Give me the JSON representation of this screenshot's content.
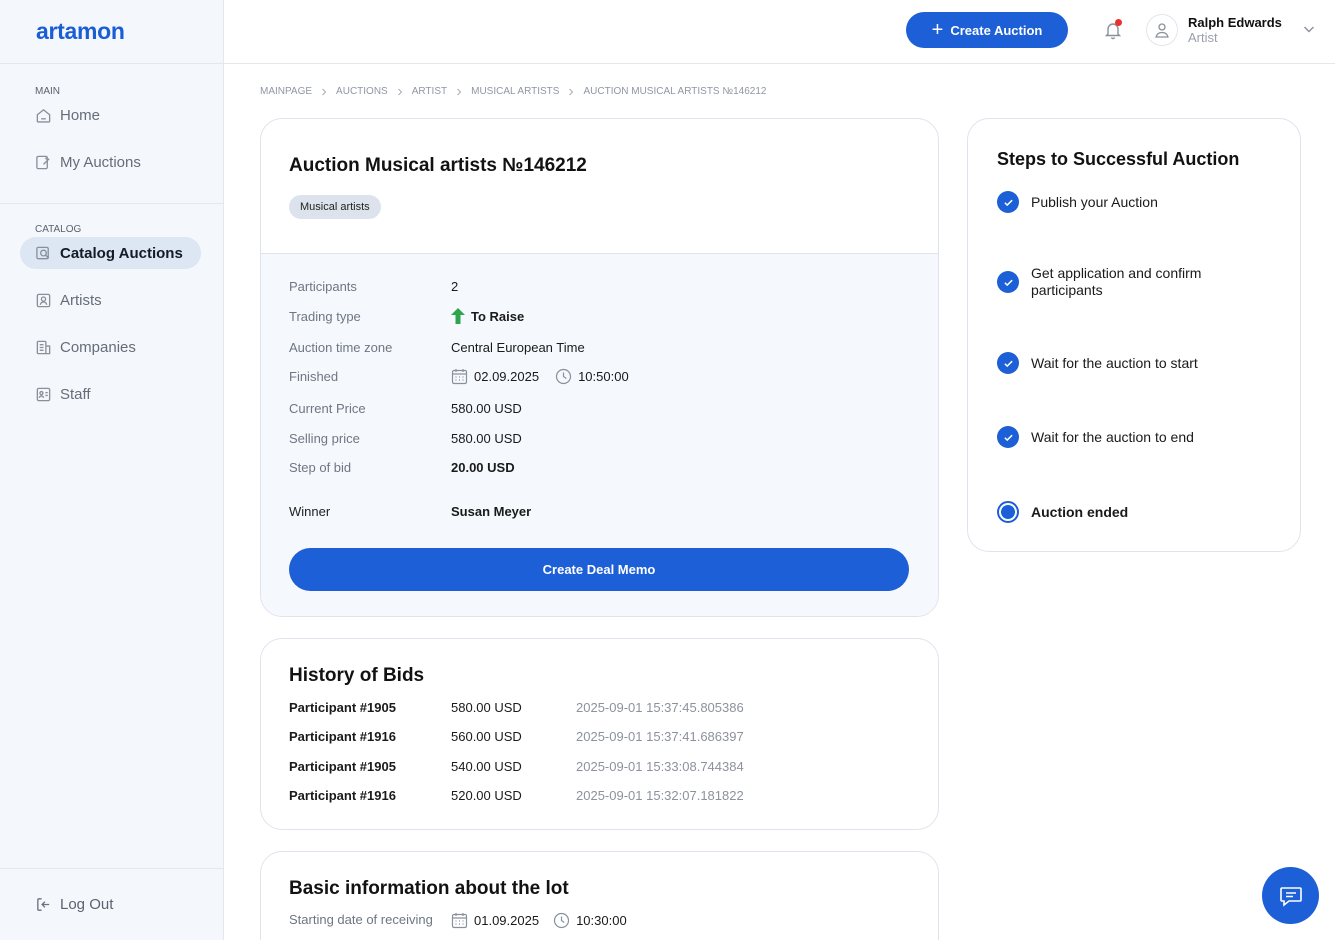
{
  "app": {
    "logo": "artamon"
  },
  "sidebar": {
    "main_heading": "MAIN",
    "main_items": [
      {
        "label": "Home",
        "icon": "home-icon"
      },
      {
        "label": "My Auctions",
        "icon": "auction-icon"
      }
    ],
    "catalog_heading": "CATALOG",
    "catalog_items": [
      {
        "label": "Catalog Auctions",
        "icon": "catalog-icon",
        "active": true
      },
      {
        "label": "Artists",
        "icon": "artists-icon"
      },
      {
        "label": "Companies",
        "icon": "companies-icon"
      },
      {
        "label": "Staff",
        "icon": "staff-icon"
      }
    ],
    "logout_label": "Log Out"
  },
  "topbar": {
    "create_label": "Create Auction",
    "user_name": "Ralph Edwards",
    "user_role": "Artist",
    "notification_dot_color": "#e8322f"
  },
  "breadcrumb": [
    "MAINPAGE",
    "AUCTIONS",
    "ARTIST",
    "MUSICAL ARTISTS",
    "AUCTION MUSICAL ARTISTS №146212"
  ],
  "auction": {
    "title": "Auction Musical artists №146212",
    "tag": "Musical artists",
    "participants_label": "Participants",
    "participants": "2",
    "trading_type_label": "Trading type",
    "trading_type": "To Raise",
    "time_zone_label": "Auction time zone",
    "time_zone": "Central European Time",
    "finished_label": "Finished",
    "finished_date": "02.09.2025",
    "finished_time": "10:50:00",
    "current_price_label": "Current Price",
    "current_price": "580.00 USD",
    "selling_price_label": "Selling price",
    "selling_price": "580.00 USD",
    "step_label": "Step of bid",
    "step": "20.00 USD",
    "winner_label": "Winner",
    "winner": "Susan Meyer",
    "deal_button": "Create Deal Memo"
  },
  "bids": {
    "title": "History of Bids",
    "rows": [
      {
        "participant": "Participant #1905",
        "amount": "580.00 USD",
        "time": "2025-09-01 15:37:45.805386"
      },
      {
        "participant": "Participant #1916",
        "amount": "560.00 USD",
        "time": "2025-09-01 15:37:41.686397"
      },
      {
        "participant": "Participant #1905",
        "amount": "540.00 USD",
        "time": "2025-09-01 15:33:08.744384"
      },
      {
        "participant": "Participant #1916",
        "amount": "520.00 USD",
        "time": "2025-09-01 15:32:07.181822"
      }
    ]
  },
  "lot": {
    "title": "Basic information about the lot",
    "start_label": "Starting date of receiving",
    "start_date": "01.09.2025",
    "start_time": "10:30:00"
  },
  "steps": {
    "title": "Steps to Successful Auction",
    "items": [
      {
        "label": "Publish your Auction",
        "done": true
      },
      {
        "label": "Get application and confirm participants",
        "done": true
      },
      {
        "label": "Wait for the auction to start",
        "done": true
      },
      {
        "label": "Wait for the auction to end",
        "done": true
      },
      {
        "label": "Auction ended",
        "done": false,
        "current": true
      }
    ]
  },
  "colors": {
    "accent": "#1c5fd6",
    "raise_arrow": "#2fa44f"
  }
}
